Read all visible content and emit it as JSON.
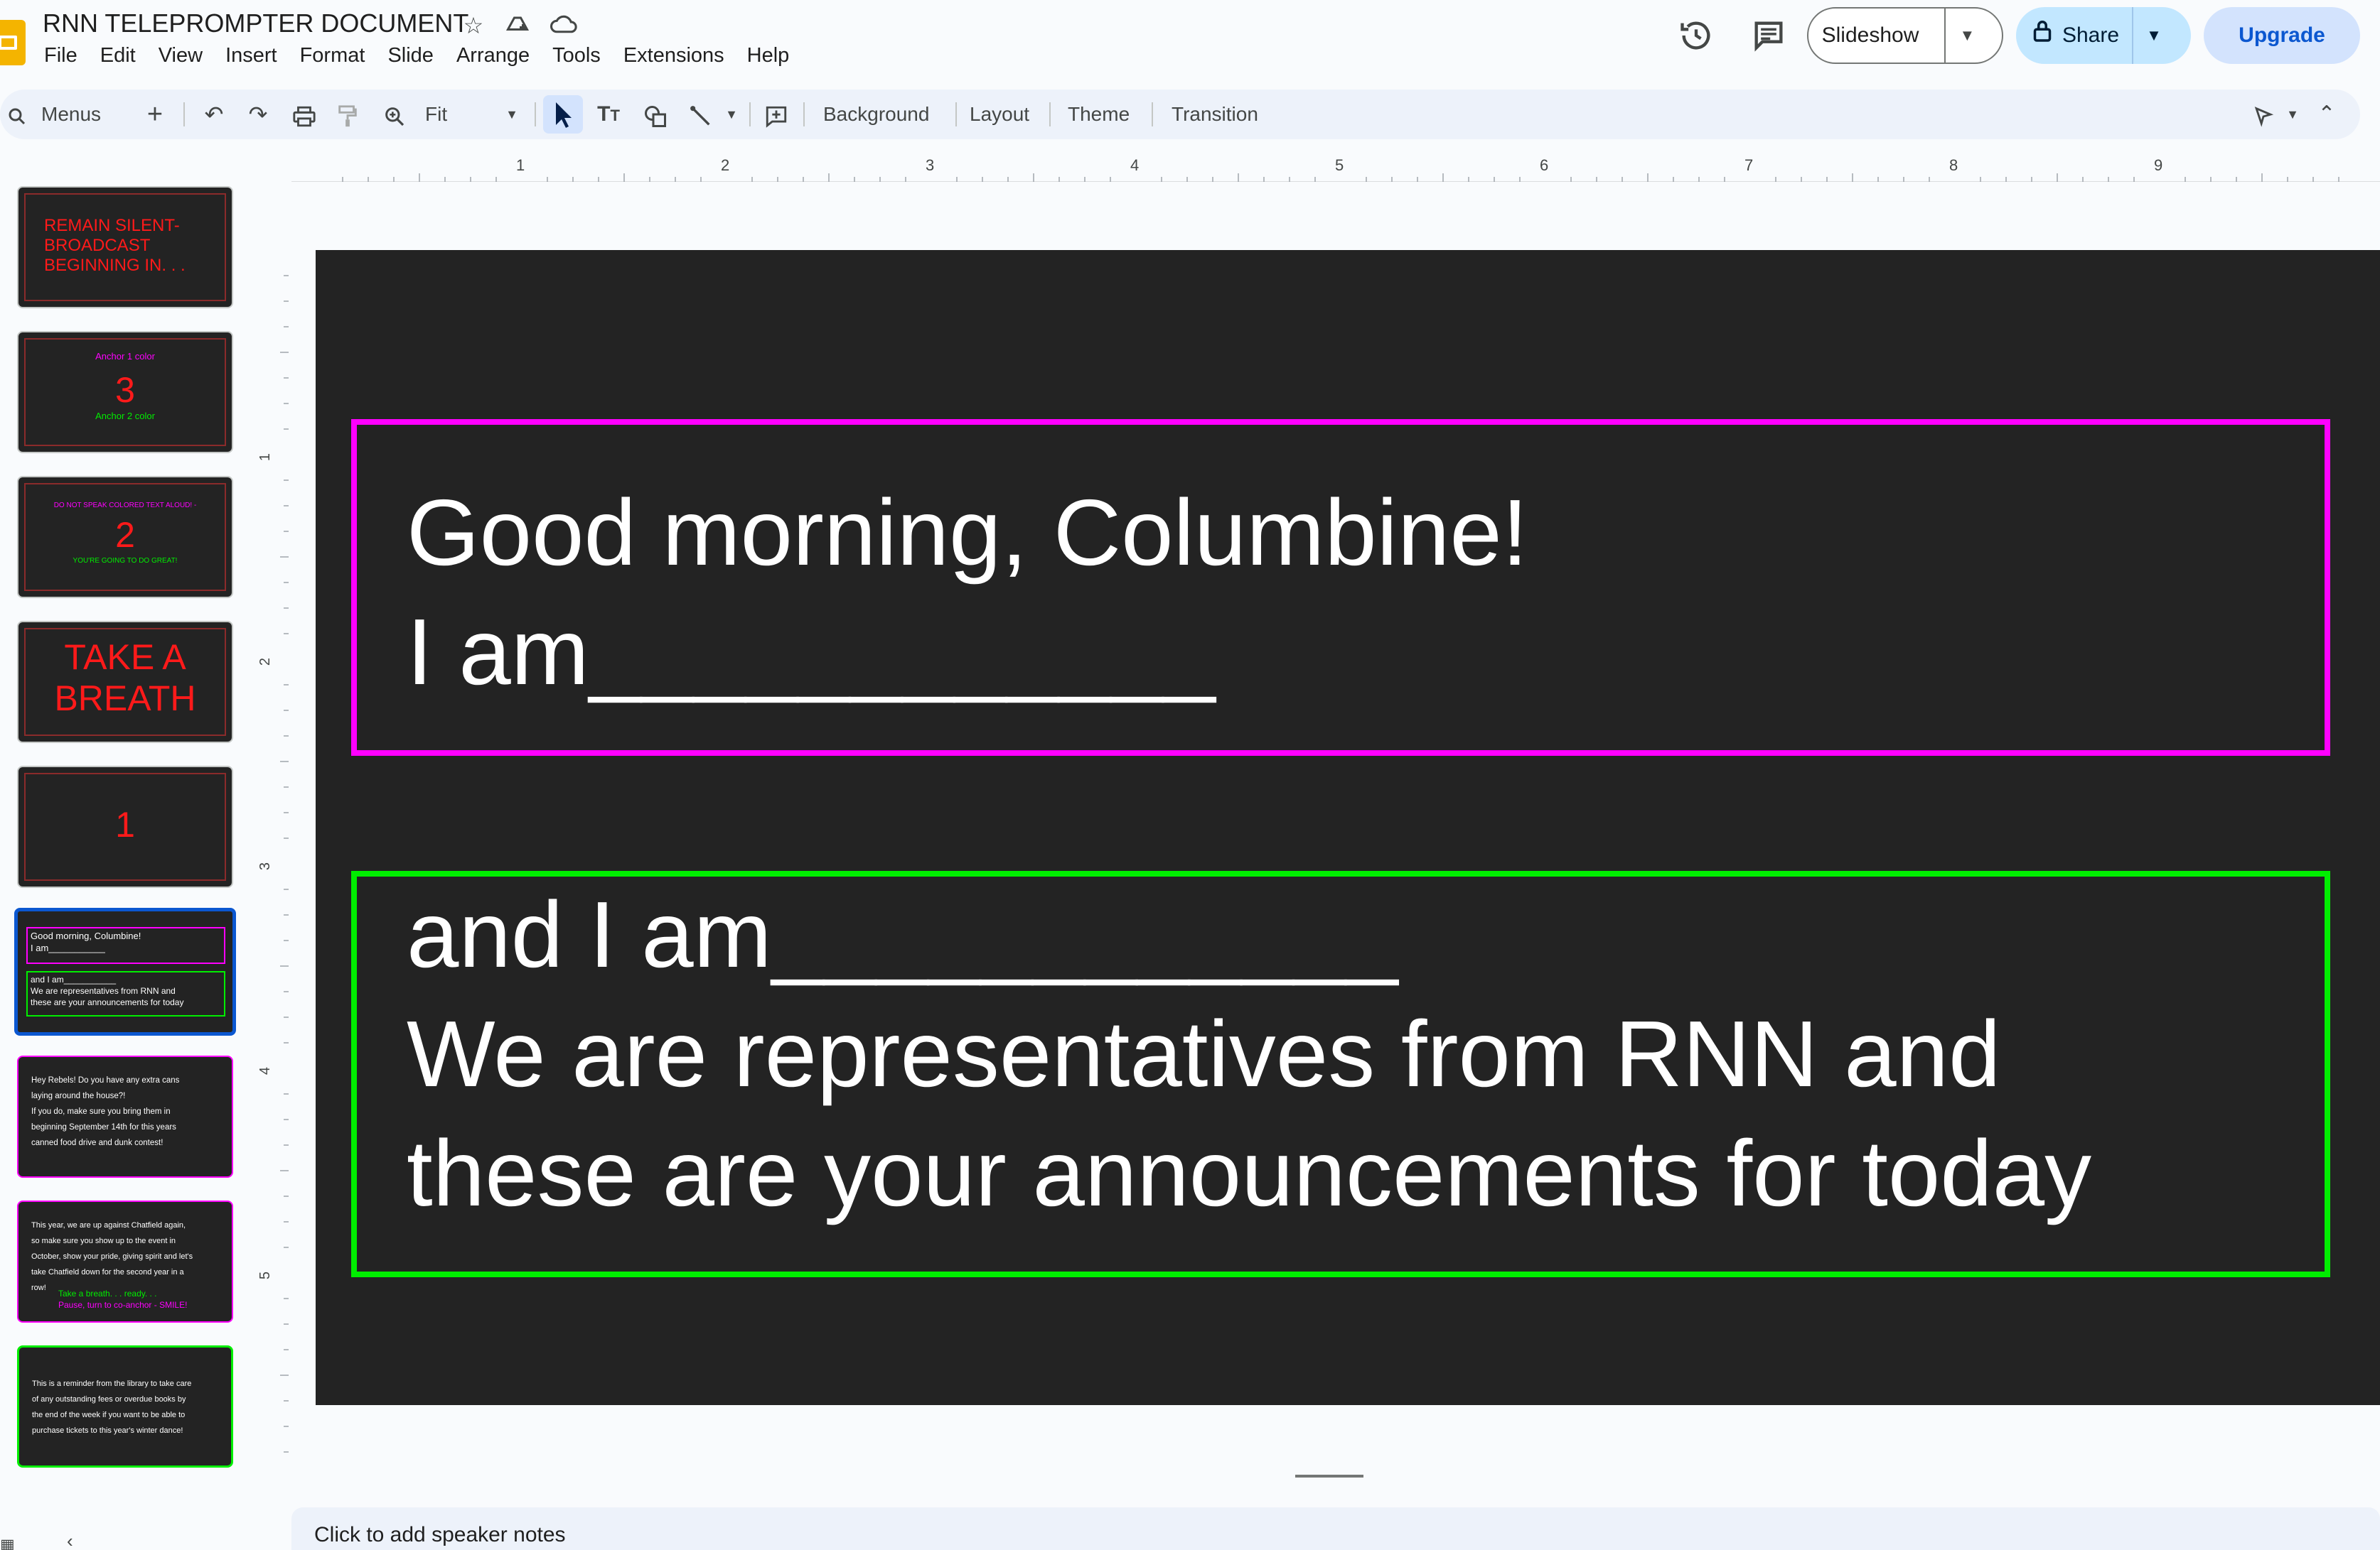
{
  "app": {
    "title": "RNN TELEPROMPTER DOCUMENT",
    "menu": [
      "File",
      "Edit",
      "View",
      "Insert",
      "Format",
      "Slide",
      "Arrange",
      "Tools",
      "Extensions",
      "Help"
    ]
  },
  "header_buttons": {
    "slideshow": "Slideshow",
    "share": "Share",
    "upgrade": "Upgrade"
  },
  "toolbar": {
    "search_label": "Menus",
    "zoom": "Fit",
    "background": "Background",
    "layout": "Layout",
    "theme": "Theme",
    "transition": "Transition"
  },
  "rulers": {
    "horizontal_ticks": [
      "1",
      "2",
      "3",
      "4",
      "5",
      "6",
      "7",
      "8",
      "9"
    ],
    "vertical_ticks": [
      "1",
      "2",
      "3",
      "4",
      "5"
    ]
  },
  "filmstrip": {
    "slides": [
      {
        "text": "REMAIN SILENT-\nBROADCAST\nBEGINNING IN. . ."
      },
      {
        "top": "Anchor 1 color",
        "number": "3",
        "bottom": "Anchor 2 color"
      },
      {
        "top": "DO NOT SPEAK COLORED TEXT ALOUD! -",
        "number": "2",
        "bottom": "YOU'RE GOING TO DO GREAT!"
      },
      {
        "text": "TAKE A\nBREATH"
      },
      {
        "number": "1"
      },
      {
        "top": "Good morning, Columbine!\nI am___________",
        "bottom": "and I am___________\nWe are representatives from RNN and\nthese are your announcements for today"
      },
      {
        "text": "Hey Rebels! Do you have any extra cans\nlaying around the house?!\nIf you do, make sure you bring them in\nbeginning September 14th for this years\ncanned food drive and dunk contest!"
      },
      {
        "text": "This year, we are up against Chatfield again,\nso make sure you show up to the event in\nOctober, show your pride, giving spirit and let's\ntake Chatfield down for the second year in a\nrow!",
        "green": "Take a breath. . . ready. . .",
        "magenta": "Pause, turn to co-anchor - SMILE!"
      },
      {
        "text": "This is a reminder from the library to take care\nof any outstanding fees or overdue books by\nthe end of the week if you want to be able to\npurchase tickets to this year's winter dance!"
      }
    ]
  },
  "slide": {
    "box1": "Good morning, Columbine!\nI am____________",
    "box2": "and I am____________\nWe are representatives from RNN and\nthese are your announcements for today",
    "box1_color": "#ff00ff",
    "box2_color": "#00ee00",
    "background": "#232323"
  },
  "notes": {
    "placeholder": "Click to add speaker notes"
  }
}
